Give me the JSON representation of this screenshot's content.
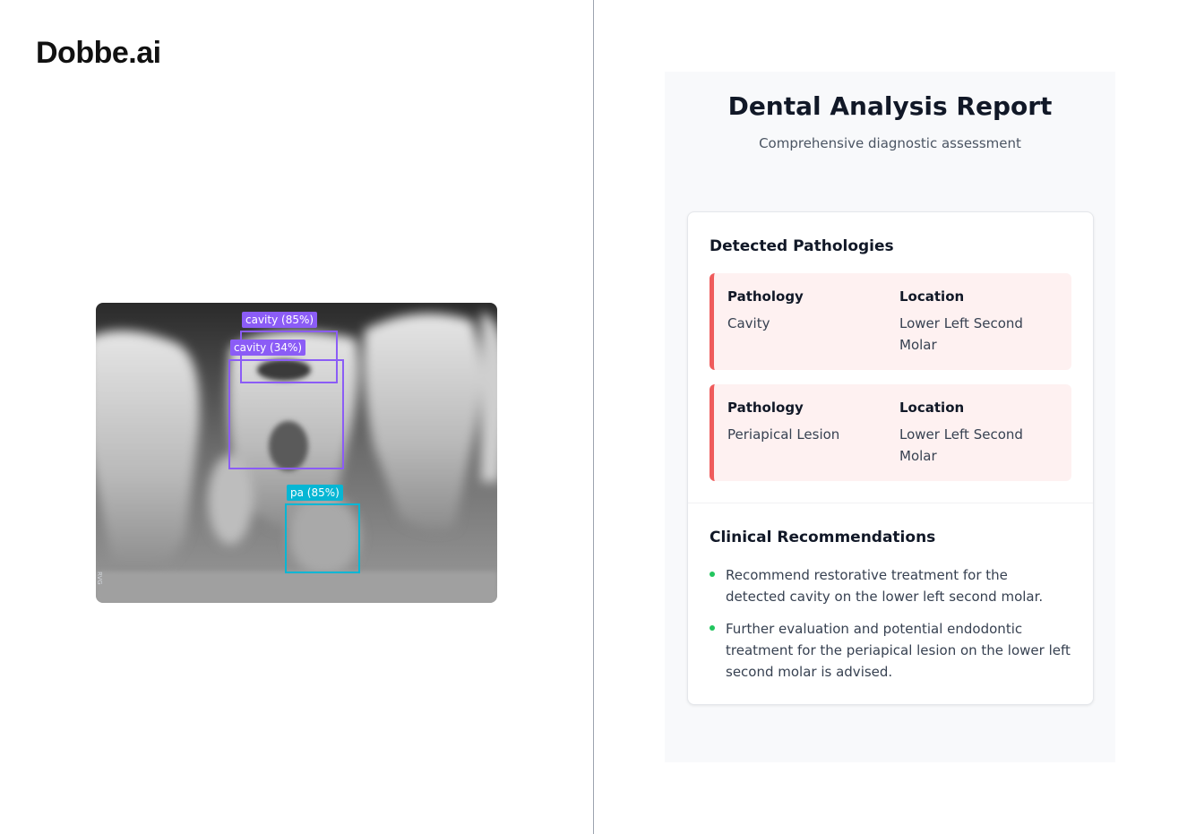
{
  "brand": {
    "logo": "Dobbe.ai"
  },
  "image_panel": {
    "side_text": "RVG",
    "detections": [
      {
        "label": "cavity (85%)",
        "color": "#8b5cf6"
      },
      {
        "label": "cavity (34%)",
        "color": "#8b5cf6"
      },
      {
        "label": "pa (85%)",
        "color": "#06b6d4"
      }
    ]
  },
  "report": {
    "title": "Dental Analysis Report",
    "subtitle": "Comprehensive diagnostic assessment",
    "pathologies": {
      "heading": "Detected Pathologies",
      "items": [
        {
          "pathology_label": "Pathology",
          "pathology": "Cavity",
          "location_label": "Location",
          "location": "Lower Left Second Molar"
        },
        {
          "pathology_label": "Pathology",
          "pathology": "Periapical Lesion",
          "location_label": "Location",
          "location": "Lower Left Second Molar"
        }
      ]
    },
    "recommendations": {
      "heading": "Clinical Recommendations",
      "items": [
        "Recommend restorative treatment for the detected cavity on the lower left second molar.",
        "Further evaluation and potential endodontic treatment for the periapical lesion on the lower left second molar is advised."
      ]
    }
  },
  "colors": {
    "accent_red": "#ef5b5b",
    "bullet_green": "#22c55e",
    "cavity": "#8b5cf6",
    "pa": "#06b6d4"
  }
}
